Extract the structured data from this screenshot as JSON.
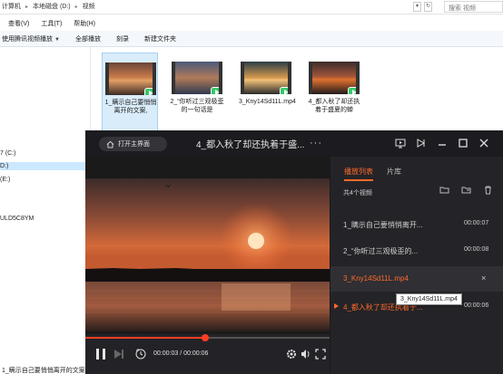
{
  "explorer": {
    "breadcrumb": [
      "计算机",
      "本地磁盘 (D:)",
      "视频"
    ],
    "search_placeholder": "搜索 视频",
    "menu": [
      "查看(V)",
      "工具(T)",
      "帮助(H)"
    ],
    "commands": [
      "使用腾讯视频播放",
      "全部播放",
      "刻录",
      "新建文件夹"
    ],
    "nav_items": [
      "7 (C:)",
      "D:)",
      "(E:)",
      "ULD5C8YM"
    ],
    "files": [
      {
        "name": "1_瞒示自己要悄悄离开的文案,"
      },
      {
        "name": "2_“你听过三观极歪的一句话是"
      },
      {
        "name": "3_Kny14Sd11L.mp4"
      },
      {
        "name": "4_都入秋了却还执着于盛夏的蝉"
      }
    ],
    "status": "1_瞒示自己要悄悄离开的文案"
  },
  "player": {
    "home_label": "打开主界面",
    "title": "4_都入秋了却还执着于盛...",
    "more_label": "···",
    "current_time": "00:00:03",
    "total_time": "00:00:06",
    "time_sep": " / ",
    "progress_fraction": 0.5,
    "accent_color": "#ff6a2a",
    "progress_color": "#ff3e24",
    "playlist": {
      "tabs": [
        "播放列表",
        "片库"
      ],
      "count_label": "共4个视频",
      "items": [
        {
          "name": "1_瞒示自己要悄悄离开...",
          "duration": "00:00:07"
        },
        {
          "name": "2_“你听过三观极歪的...",
          "duration": "00:00:08"
        },
        {
          "name": "3_Kny14Sd11L.mp4",
          "close": "×"
        },
        {
          "name": "4_都入秋了却还执着于...",
          "duration": "00:00:06"
        }
      ],
      "tooltip": "3_Kny14Sd11L.mp4"
    }
  }
}
